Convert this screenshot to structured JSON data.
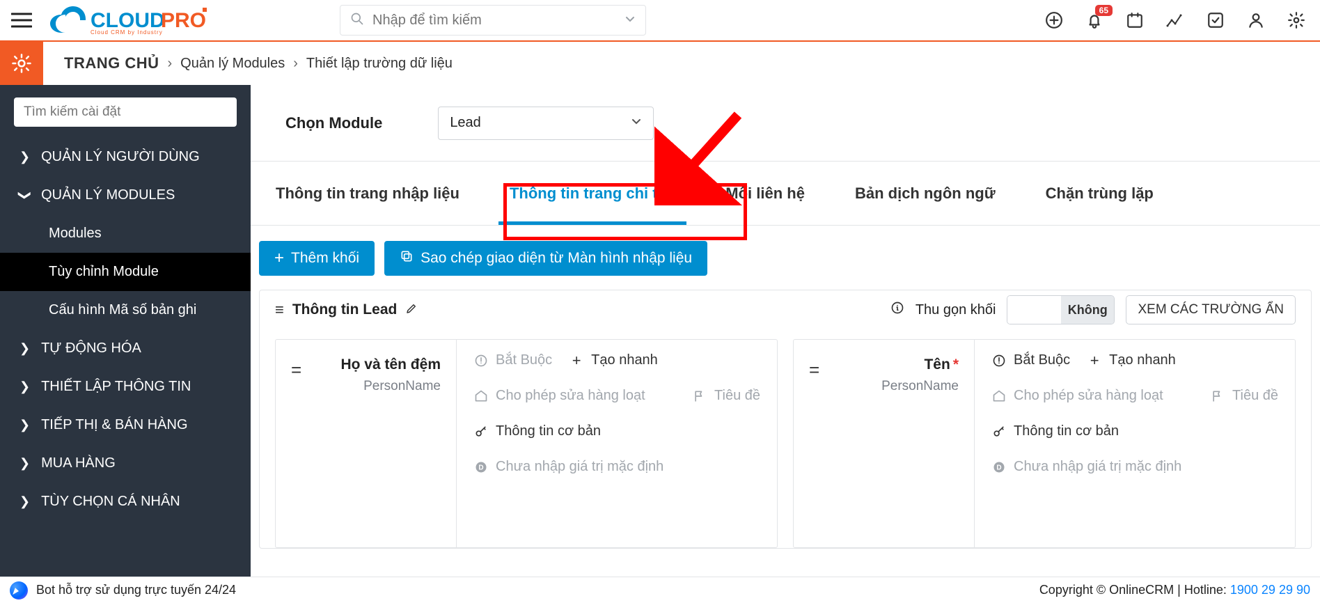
{
  "topbar": {
    "search_placeholder": "Nhập để tìm kiếm",
    "notif_badge": "65"
  },
  "breadcrumb": {
    "home": "TRANG CHỦ",
    "items": [
      "Quản lý Modules",
      "Thiết lập trường dữ liệu"
    ]
  },
  "sidebar": {
    "search_placeholder": "Tìm kiếm cài đặt",
    "menu": [
      {
        "label": "QUẢN LÝ NGƯỜI DÙNG",
        "open": false
      },
      {
        "label": "QUẢN LÝ MODULES",
        "open": true,
        "children": [
          {
            "label": "Modules"
          },
          {
            "label": "Tùy chỉnh Module",
            "active": true
          },
          {
            "label": "Cấu hình Mã số bản ghi"
          }
        ]
      },
      {
        "label": "TỰ ĐỘNG HÓA",
        "open": false
      },
      {
        "label": "THIẾT LẬP THÔNG TIN",
        "open": false
      },
      {
        "label": "TIẾP THỊ & BÁN HÀNG",
        "open": false
      },
      {
        "label": "MUA HÀNG",
        "open": false
      },
      {
        "label": "TÙY CHỌN CÁ NHÂN",
        "open": false
      }
    ]
  },
  "module_picker": {
    "label": "Chọn Module",
    "value": "Lead"
  },
  "tabs": [
    {
      "label": "Thông tin trang nhập liệu"
    },
    {
      "label": "Thông tin trang chi tiết",
      "active": true
    },
    {
      "label": "Mối liên hệ"
    },
    {
      "label": "Bản dịch ngôn ngữ"
    },
    {
      "label": "Chặn trùng lặp"
    }
  ],
  "actions": {
    "add_block": "Thêm khối",
    "copy_layout": "Sao chép giao diện từ Màn hình nhập liệu"
  },
  "panel": {
    "title": "Thông tin Lead",
    "collapse_label": "Thu gọn khối",
    "toggle_off": "Không",
    "hidden_btn": "XEM CÁC TRƯỜNG ẨN"
  },
  "field_labels": {
    "required": "Bắt Buộc",
    "quick": "Tạo nhanh",
    "mass": "Cho phép sửa hàng loạt",
    "title": "Tiêu đề",
    "basic": "Thông tin cơ bản",
    "default": "Chưa nhập giá trị mặc định"
  },
  "fields": [
    {
      "name": "Họ và tên đệm",
      "type": "PersonName",
      "required_active": false
    },
    {
      "name": "Tên",
      "type": "PersonName",
      "required_active": true,
      "mark_required": true
    }
  ],
  "footer": {
    "bot": "Bot hỗ trợ sử dụng trực tuyến 24/24",
    "copyright": "Copyright © OnlineCRM",
    "hotline_label": "Hotline: ",
    "hotline_number": "1900 29 29 90"
  }
}
